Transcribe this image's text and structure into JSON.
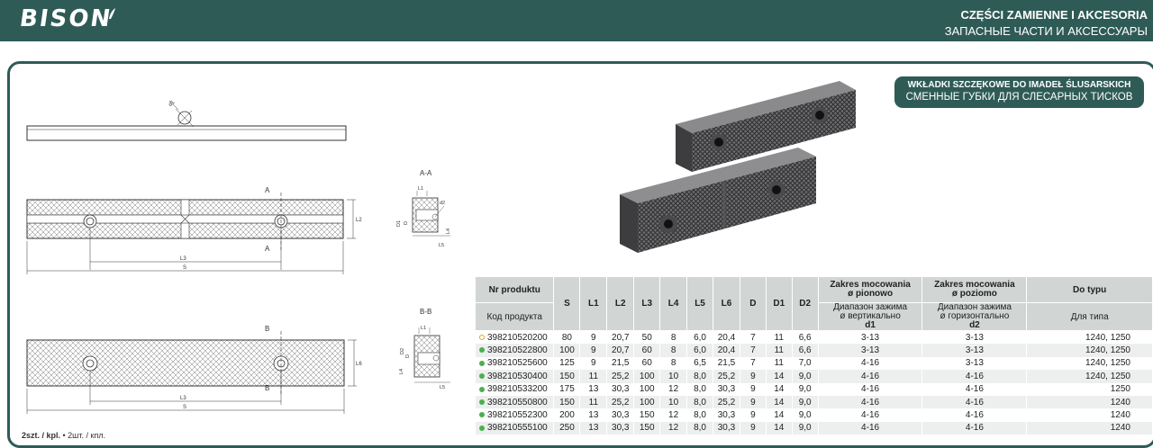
{
  "brand": {
    "logo": "BISON"
  },
  "header": {
    "title_pl": "CZĘŚCI ZAMIENNE I AKCESORIA",
    "title_ru": "ЗАПАСНЫЕ ЧАСТИ И АКСЕССУАРЫ"
  },
  "product": {
    "title_pl": "WKŁADKI SZCZĘKOWE DO IMADEŁ ŚLUSARSKICH",
    "title_ru": "СМЕННЫЕ ГУБКИ ДЛЯ СЛЕСАРНЫХ ТИСКОВ"
  },
  "drawing": {
    "sec_aa": "A-A",
    "sec_bb": "B-B",
    "a": "A",
    "b": "B",
    "L1": "L1",
    "L2": "L2",
    "L3": "L3",
    "L4": "L4",
    "L5": "L5",
    "L6": "L6",
    "S": "S",
    "D": "D",
    "D1": "D1",
    "D2": "D2",
    "d1": "d1",
    "d2": "d2"
  },
  "table": {
    "h_nr_pl": "Nr produktu",
    "h_nr_ru": "Код продукта",
    "h_S": "S",
    "h_L1": "L1",
    "h_L2": "L2",
    "h_L3": "L3",
    "h_L4": "L4",
    "h_L5": "L5",
    "h_L6": "L6",
    "h_D": "D",
    "h_D1": "D1",
    "h_D2": "D2",
    "h_d1_pl1": "Zakres mocowania",
    "h_d1_pl2": "ø pionowo",
    "h_d1_ru1": "Диапазон зажима",
    "h_d1_ru2": "ø вертикально",
    "h_d1": "d1",
    "h_d2_pl1": "Zakres mocowania",
    "h_d2_pl2": "ø poziomo",
    "h_d2_ru1": "Диапазон зажима",
    "h_d2_ru2": "ø горизонтально",
    "h_d2": "d2",
    "h_type_pl": "Do typu",
    "h_type_ru": "Для типа",
    "rows": [
      {
        "nr": "398210520200",
        "status": "ring",
        "S": "80",
        "L1": "9",
        "L2": "20,7",
        "L3": "50",
        "L4": "8",
        "L5": "6,0",
        "L6": "20,4",
        "D": "7",
        "D1": "11",
        "D2": "6,6",
        "d1": "3-13",
        "d2": "3-13",
        "type": "1240, 1250"
      },
      {
        "nr": "398210522800",
        "status": "dot",
        "S": "100",
        "L1": "9",
        "L2": "20,7",
        "L3": "60",
        "L4": "8",
        "L5": "6,0",
        "L6": "20,4",
        "D": "7",
        "D1": "11",
        "D2": "6,6",
        "d1": "3-13",
        "d2": "3-13",
        "type": "1240, 1250"
      },
      {
        "nr": "398210525600",
        "status": "dot",
        "S": "125",
        "L1": "9",
        "L2": "21,5",
        "L3": "60",
        "L4": "8",
        "L5": "6,5",
        "L6": "21,5",
        "D": "7",
        "D1": "11",
        "D2": "7,0",
        "d1": "4-16",
        "d2": "3-13",
        "type": "1240, 1250"
      },
      {
        "nr": "398210530400",
        "status": "dot",
        "S": "150",
        "L1": "11",
        "L2": "25,2",
        "L3": "100",
        "L4": "10",
        "L5": "8,0",
        "L6": "25,2",
        "D": "9",
        "D1": "14",
        "D2": "9,0",
        "d1": "4-16",
        "d2": "4-16",
        "type": "1240, 1250"
      },
      {
        "nr": "398210533200",
        "status": "dot",
        "S": "175",
        "L1": "13",
        "L2": "30,3",
        "L3": "100",
        "L4": "12",
        "L5": "8,0",
        "L6": "30,3",
        "D": "9",
        "D1": "14",
        "D2": "9,0",
        "d1": "4-16",
        "d2": "4-16",
        "type": "1250"
      },
      {
        "nr": "398210550800",
        "status": "dot",
        "S": "150",
        "L1": "11",
        "L2": "25,2",
        "L3": "100",
        "L4": "10",
        "L5": "8,0",
        "L6": "25,2",
        "D": "9",
        "D1": "14",
        "D2": "9,0",
        "d1": "4-16",
        "d2": "4-16",
        "type": "1240"
      },
      {
        "nr": "398210552300",
        "status": "dot",
        "S": "200",
        "L1": "13",
        "L2": "30,3",
        "L3": "150",
        "L4": "12",
        "L5": "8,0",
        "L6": "30,3",
        "D": "9",
        "D1": "14",
        "D2": "9,0",
        "d1": "4-16",
        "d2": "4-16",
        "type": "1240"
      },
      {
        "nr": "398210555100",
        "status": "dot",
        "S": "250",
        "L1": "13",
        "L2": "30,3",
        "L3": "150",
        "L4": "12",
        "L5": "8,0",
        "L6": "30,3",
        "D": "9",
        "D1": "14",
        "D2": "9,0",
        "d1": "4-16",
        "d2": "4-16",
        "type": "1240"
      }
    ]
  },
  "footnote": {
    "bold": "2szt. / kpl.",
    "rest": " • 2шт. / кпл."
  },
  "colors": {
    "brand": "#2f5b57",
    "ring": "#e0a81e",
    "dot": "#4caf50"
  }
}
